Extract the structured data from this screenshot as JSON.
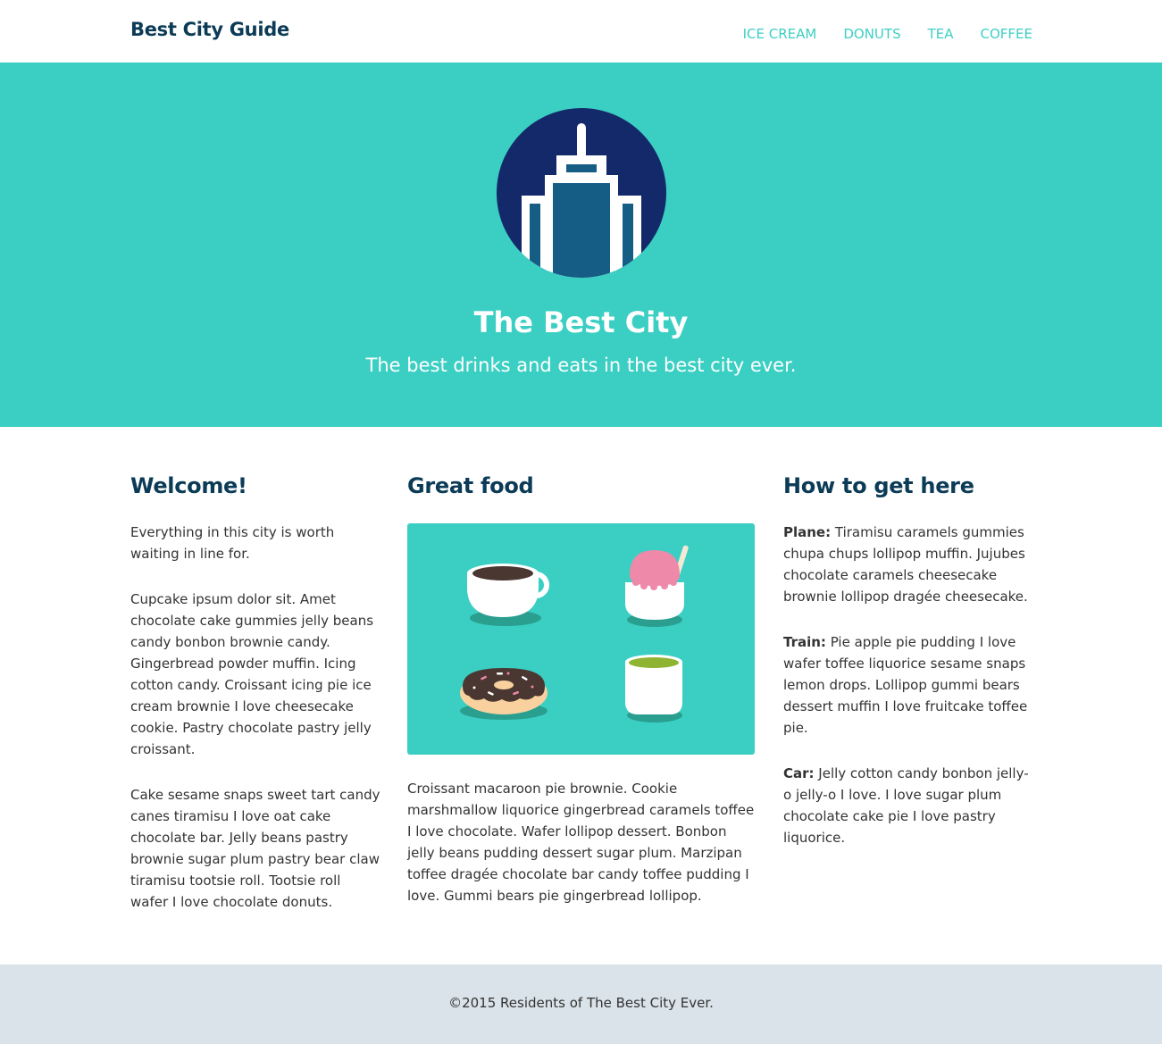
{
  "header": {
    "brand": "Best City Guide",
    "nav": [
      "ICE CREAM",
      "DONUTS",
      "TEA",
      "COFFEE"
    ]
  },
  "hero": {
    "logo_icon": "skyscraper-icon",
    "title": "The Best City",
    "subtitle": "The best drinks and eats in the best city ever."
  },
  "columns": {
    "welcome": {
      "heading": "Welcome!",
      "paragraphs": [
        "Everything in this city is worth waiting in line for.",
        "Cupcake ipsum dolor sit. Amet chocolate cake gummies jelly beans candy bonbon brownie candy. Gingerbread powder muffin. Icing cotton candy. Croissant icing pie ice cream brownie I love cheesecake cookie. Pastry chocolate pastry jelly croissant.",
        "Cake sesame snaps sweet tart candy canes tiramisu I love oat cake chocolate bar. Jelly beans pastry brownie sugar plum pastry bear claw tiramisu tootsie roll. Tootsie roll wafer I love chocolate donuts."
      ]
    },
    "food": {
      "heading": "Great food",
      "image_icons": [
        "coffee-cup-icon",
        "ice-cream-icon",
        "donut-icon",
        "tea-cup-icon"
      ],
      "paragraph": "Croissant macaroon pie brownie. Cookie marshmallow liquorice gingerbread caramels toffee I love chocolate. Wafer lollipop dessert. Bonbon jelly beans pudding dessert sugar plum. Marzipan toffee dragée chocolate bar candy toffee pudding I love. Gummi bears pie gingerbread lollipop."
    },
    "travel": {
      "heading": "How to get here",
      "items": [
        {
          "label": "Plane:",
          "text": " Tiramisu caramels gummies chupa chups lollipop muffin. Jujubes chocolate caramels cheesecake brownie lollipop dragée cheesecake."
        },
        {
          "label": "Train:",
          "text": " Pie apple pie pudding I love wafer toffee liquorice sesame snaps lemon drops. Lollipop gummi bears dessert muffin I love fruitcake toffee pie."
        },
        {
          "label": "Car:",
          "text": " Jelly cotton candy bonbon jelly-o jelly-o I love. I love sugar plum chocolate cake pie I love pastry liquorice."
        }
      ]
    }
  },
  "footer": {
    "copyright": "©2015 Residents of The Best City Ever."
  },
  "colors": {
    "accent": "#3bcfc3",
    "heading": "#0c3b57",
    "footer_bg": "#d9e3e9",
    "logo_circle": "#14296a",
    "logo_building": "#165d86"
  }
}
